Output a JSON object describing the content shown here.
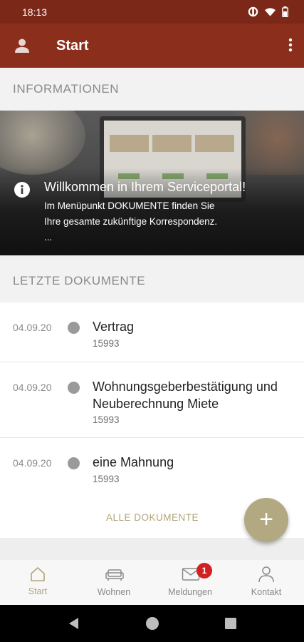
{
  "statusbar": {
    "time": "18:13"
  },
  "appbar": {
    "title": "Start"
  },
  "sections": {
    "informationen": "INFORMATIONEN",
    "letzte_dokumente": "LETZTE DOKUMENTE"
  },
  "banner": {
    "headline": "Willkommen in Ihrem Serviceportal!",
    "body_line1": "Im Menüpunkt DOKUMENTE finden Sie",
    "body_line2": "Ihre gesamte zukünftige Korrespondenz.",
    "body_line3": "..."
  },
  "documents": [
    {
      "date": "04.09.20",
      "title": "Vertrag",
      "number": "15993"
    },
    {
      "date": "04.09.20",
      "title": "Wohnungsgeberbestätigung und Neuberechnung Miete",
      "number": "15993"
    },
    {
      "date": "04.09.20",
      "title": "eine Mahnung",
      "number": "15993"
    }
  ],
  "all_documents_label": "ALLE DOKUMENTE",
  "fab_label": "+",
  "bottom_nav": [
    {
      "label": "Start",
      "active": true
    },
    {
      "label": "Wohnen"
    },
    {
      "label": "Meldungen",
      "badge": "1"
    },
    {
      "label": "Kontakt"
    }
  ],
  "colors": {
    "appbar": "#8c2e1c",
    "accent": "#b0a57a",
    "badge": "#d32020"
  }
}
